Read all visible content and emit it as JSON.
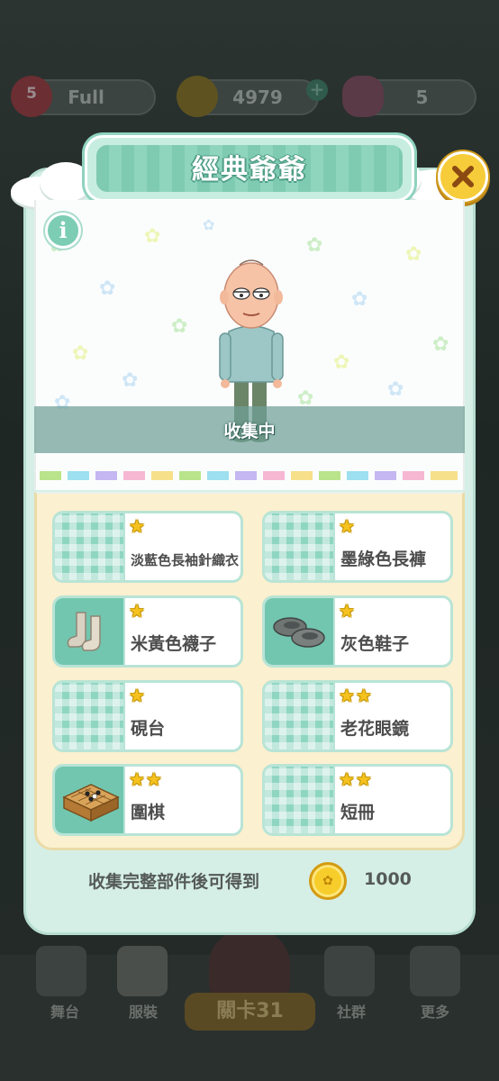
{
  "hud": {
    "lives_count": "5",
    "lives_status": "Full",
    "coins": "4979",
    "flowers": "5"
  },
  "modal": {
    "title": "經典爺爺",
    "info_label": "i",
    "status": "收集中",
    "items": [
      {
        "name": "淡藍色長袖針織衣",
        "stars": "★",
        "thumb": "placeholder"
      },
      {
        "name": "墨綠色長褲",
        "stars": "★",
        "thumb": "placeholder"
      },
      {
        "name": "米黃色襪子",
        "stars": "★",
        "thumb": "socks-icon"
      },
      {
        "name": "灰色鞋子",
        "stars": "★",
        "thumb": "shoes-icon"
      },
      {
        "name": "硯台",
        "stars": "★",
        "thumb": "placeholder"
      },
      {
        "name": "老花眼鏡",
        "stars": "★★",
        "thumb": "placeholder"
      },
      {
        "name": "圍棋",
        "stars": "★★",
        "thumb": "go-board-icon"
      },
      {
        "name": "短冊",
        "stars": "★★",
        "thumb": "placeholder"
      }
    ],
    "reward_label": "收集完整部件後可得到",
    "reward_value": "1000"
  },
  "nav": {
    "stage": "舞台",
    "clothes": "服裝",
    "level": "關卡31",
    "social": "社群",
    "more": "更多"
  },
  "colors": {
    "mint": "#80cdb4",
    "modal_bg": "#d5efe7",
    "panel_bg": "#fbf0cf",
    "coin": "#f6cd2a",
    "star": "#f5c21f"
  }
}
